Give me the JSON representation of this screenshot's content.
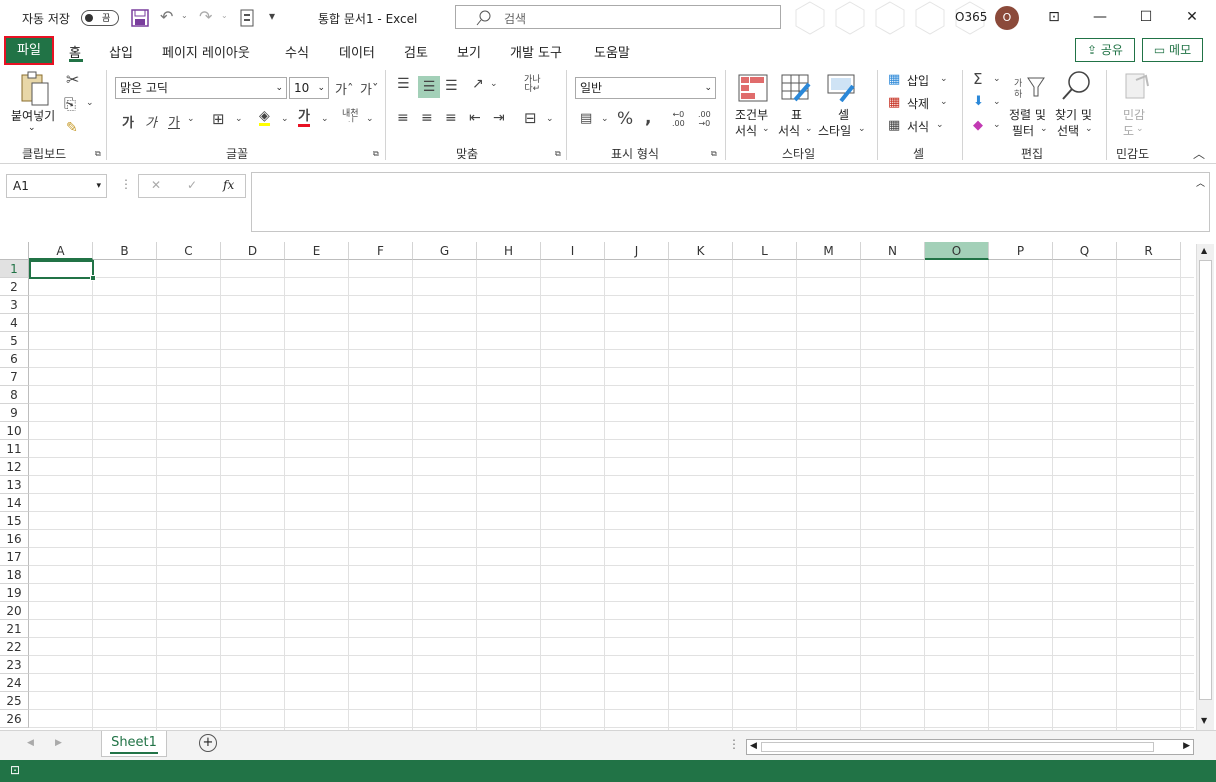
{
  "titlebar": {
    "autosave_label": "자동 저장",
    "autosave_state": "끔",
    "doc_title": "통합 문서1  -  Excel",
    "search_placeholder": "검색",
    "account": "O365",
    "avatar_initial": "O"
  },
  "tabs": [
    "파일",
    "홈",
    "삽입",
    "페이지 레이아웃",
    "수식",
    "데이터",
    "검토",
    "보기",
    "개발 도구",
    "도움말"
  ],
  "share_label": "공유",
  "memo_label": "메모",
  "ribbon": {
    "clipboard": {
      "paste": "붙여넣기",
      "label": "클립보드"
    },
    "font": {
      "name": "맑은 고딕",
      "size": "10",
      "label": "글꼴"
    },
    "align": {
      "label": "맞춤"
    },
    "number": {
      "format": "일반",
      "label": "표시 형식"
    },
    "styles": {
      "cond_line1": "조건부",
      "cond_line2": "서식",
      "table_line1": "표",
      "table_line2": "서식",
      "cell_line1": "셀",
      "cell_line2": "스타일",
      "label": "스타일"
    },
    "cells": {
      "insert": "삽입",
      "delete": "삭제",
      "format": "서식",
      "label": "셀"
    },
    "editing": {
      "sort_line1": "정렬 및",
      "sort_line2": "필터",
      "find_line1": "찾기 및",
      "find_line2": "선택",
      "label": "편집"
    },
    "sensitivity": {
      "line1": "민감",
      "line2": "도",
      "label": "민감도"
    }
  },
  "formula_bar": {
    "name_box": "A1",
    "formula": ""
  },
  "columns": [
    "A",
    "B",
    "C",
    "D",
    "E",
    "F",
    "G",
    "H",
    "I",
    "J",
    "K",
    "L",
    "M",
    "N",
    "O",
    "P",
    "Q",
    "R"
  ],
  "selected_column": "O",
  "rows": [
    "1",
    "2",
    "3",
    "4",
    "5",
    "6",
    "7",
    "8",
    "9",
    "10",
    "11",
    "12",
    "13",
    "14",
    "15",
    "16",
    "17",
    "18",
    "19",
    "20",
    "21",
    "22",
    "23",
    "24",
    "25",
    "26"
  ],
  "sheet_tab": "Sheet1",
  "accent": "#217346"
}
